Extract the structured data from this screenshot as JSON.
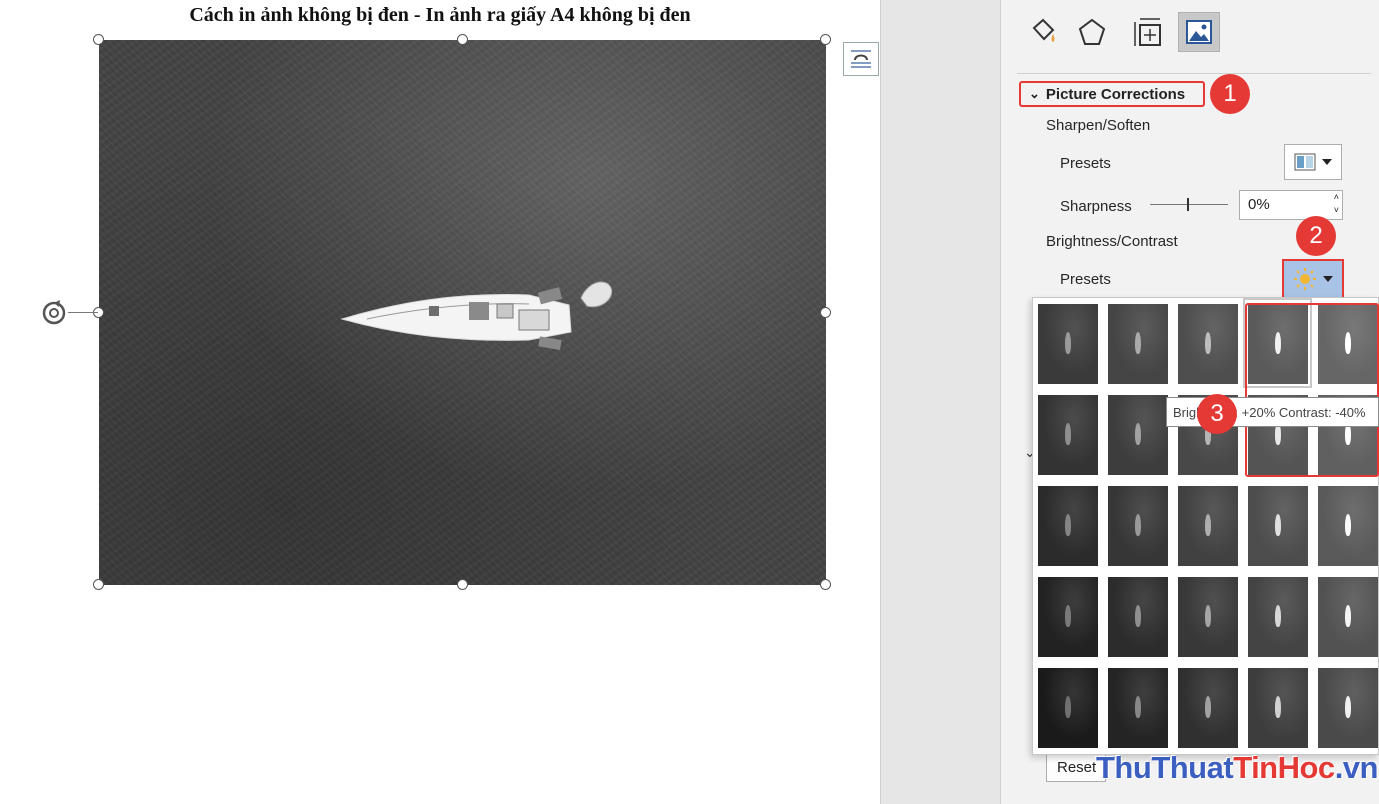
{
  "document": {
    "title": "Cách in ảnh không bị đen - In ảnh ra giấy A4 không bị đen"
  },
  "pane": {
    "tabs": [
      {
        "icon": "fill-line-icon",
        "active": false
      },
      {
        "icon": "effects-icon",
        "active": false
      },
      {
        "icon": "size-properties-icon",
        "active": false
      },
      {
        "icon": "picture-icon",
        "active": true
      }
    ],
    "section_title": "Picture Corrections",
    "sharpen_soften": {
      "heading": "Sharpen/Soften",
      "presets_label": "Presets",
      "sharpness_label": "Sharpness",
      "sharpness_value": "0%"
    },
    "brightness_contrast": {
      "heading": "Brightness/Contrast",
      "presets_label": "Presets"
    },
    "reset_label": "Reset"
  },
  "gallery": {
    "tooltip": "Brightness: +20% Contrast: -40%",
    "rows": [
      [
        "#3a3a3a",
        "#454545",
        "#4e4e4e",
        "#5a5a5a",
        "#666666"
      ],
      [
        "#333333",
        "#3d3d3d",
        "#484848",
        "#545454",
        "#606060"
      ],
      [
        "#2b2b2b",
        "#363636",
        "#414141",
        "#4d4d4d",
        "#5a5a5a"
      ],
      [
        "#222222",
        "#2c2c2c",
        "#383838",
        "#444444",
        "#525252"
      ],
      [
        "#1a1a1a",
        "#242424",
        "#303030",
        "#3d3d3d",
        "#4a4a4a"
      ]
    ],
    "boat_colors": [
      [
        "#9a9a9a",
        "#aaaaaa",
        "#bdbdbd",
        "#f0f0f0",
        "#ffffff"
      ],
      [
        "#8f8f8f",
        "#a2a2a2",
        "#b5b5b5",
        "#e8e8e8",
        "#ffffff"
      ],
      [
        "#858585",
        "#999999",
        "#aeaeae",
        "#e0e0e0",
        "#fafafa"
      ],
      [
        "#7a7a7a",
        "#909090",
        "#a6a6a6",
        "#d8d8d8",
        "#f5f5f5"
      ],
      [
        "#707070",
        "#888888",
        "#a0a0a0",
        "#d0d0d0",
        "#f0f0f0"
      ]
    ]
  },
  "callouts": [
    "1",
    "2",
    "3"
  ],
  "watermark": {
    "part1": "Thu",
    "part2": "Thuat",
    "part3": "TinHoc",
    "part4": ".vn"
  },
  "colors": {
    "accent_red": "#e53935",
    "selected_button": "#a9c3e6"
  }
}
